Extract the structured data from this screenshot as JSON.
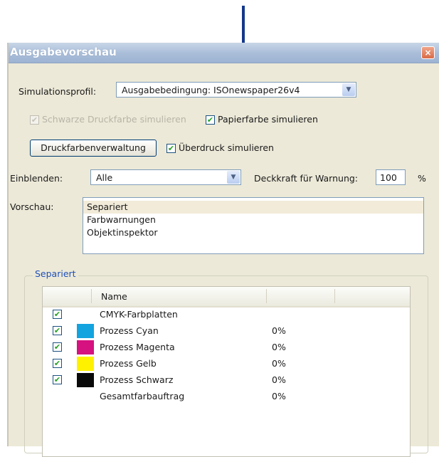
{
  "window": {
    "title": "Ausgabevorschau",
    "close_glyph": "×"
  },
  "simulation": {
    "label": "Simulationsprofil:",
    "value": "Ausgabebedingung: ISOnewspaper26v4"
  },
  "options": {
    "black_ink": {
      "label": "Schwarze Druckfarbe simulieren",
      "checked": true,
      "disabled": true
    },
    "paper_color": {
      "label": "Papierfarbe simulieren",
      "checked": true
    },
    "overprint": {
      "label": "Überdruck simulieren",
      "checked": true
    }
  },
  "ink_manager_button": "Druckfarbenverwaltung",
  "show": {
    "label": "Einblenden:",
    "value": "Alle"
  },
  "opacity": {
    "label": "Deckkraft für Warnung:",
    "value": "100",
    "unit": "%"
  },
  "preview": {
    "label": "Vorschau:",
    "items": [
      "Separiert",
      "Farbwarnungen",
      "Objektinspektor"
    ],
    "selected": "Separiert"
  },
  "separations": {
    "group_title": "Separiert",
    "columns": {
      "name": "Name"
    },
    "rows": [
      {
        "checked": true,
        "name": "CMYK-Farbplatten",
        "value": "",
        "color": ""
      },
      {
        "checked": true,
        "name": "Prozess Cyan",
        "value": "0%",
        "color": "#13a3de"
      },
      {
        "checked": true,
        "name": "Prozess Magenta",
        "value": "0%",
        "color": "#d5127f"
      },
      {
        "checked": true,
        "name": "Prozess Gelb",
        "value": "0%",
        "color": "#fff200"
      },
      {
        "checked": true,
        "name": "Prozess Schwarz",
        "value": "0%",
        "color": "#0a0a0a"
      },
      {
        "checked": false,
        "name": "Gesamtfarbauftrag",
        "value": "0%",
        "color": ""
      }
    ]
  },
  "icons": {
    "arrow": "down-arrow-annotation",
    "check": "✔",
    "dropdown": "▼"
  },
  "colors": {
    "arrow": "#14388a",
    "titlebar": "#a9bdd8",
    "dialog_bg": "#ece9d8",
    "selection": "#f2ebd9"
  }
}
